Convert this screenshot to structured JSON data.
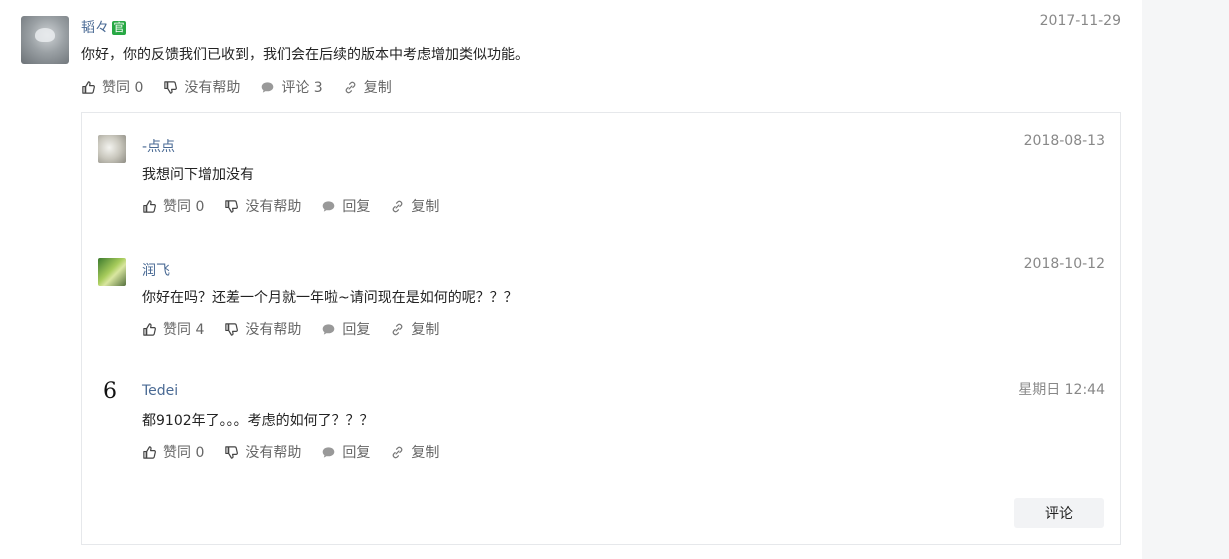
{
  "main_comment": {
    "author": "韬々",
    "official_badge": "官",
    "date": "2017-11-29",
    "content": "你好，你的反馈我们已收到，我们会在后续的版本中考虑增加类似功能。",
    "actions": {
      "like": "赞同 0",
      "unhelpful": "没有帮助",
      "comment": "评论 3",
      "copy": "复制"
    }
  },
  "replies": [
    {
      "author": "-点点",
      "date": "2018-08-13",
      "content": "我想问下增加没有",
      "actions": {
        "like": "赞同 0",
        "unhelpful": "没有帮助",
        "reply": "回复",
        "copy": "复制"
      }
    },
    {
      "author": "润飞",
      "date": "2018-10-12",
      "content": "你好在吗？还差一个月就一年啦~请问现在是如何的呢？？？",
      "actions": {
        "like": "赞同 4",
        "unhelpful": "没有帮助",
        "reply": "回复",
        "copy": "复制"
      }
    },
    {
      "author": "Tedei",
      "avatar_glyph": "6",
      "date": "星期日 12:44",
      "content": "都9102年了。。。考虑的如何了？？？",
      "actions": {
        "like": "赞同 0",
        "unhelpful": "没有帮助",
        "reply": "回复",
        "copy": "复制"
      }
    }
  ],
  "comment_button_label": "评论",
  "colors": {
    "name": "#4a6a94",
    "badge": "#27a844",
    "muted": "#888888",
    "border": "#e6e8eb"
  }
}
